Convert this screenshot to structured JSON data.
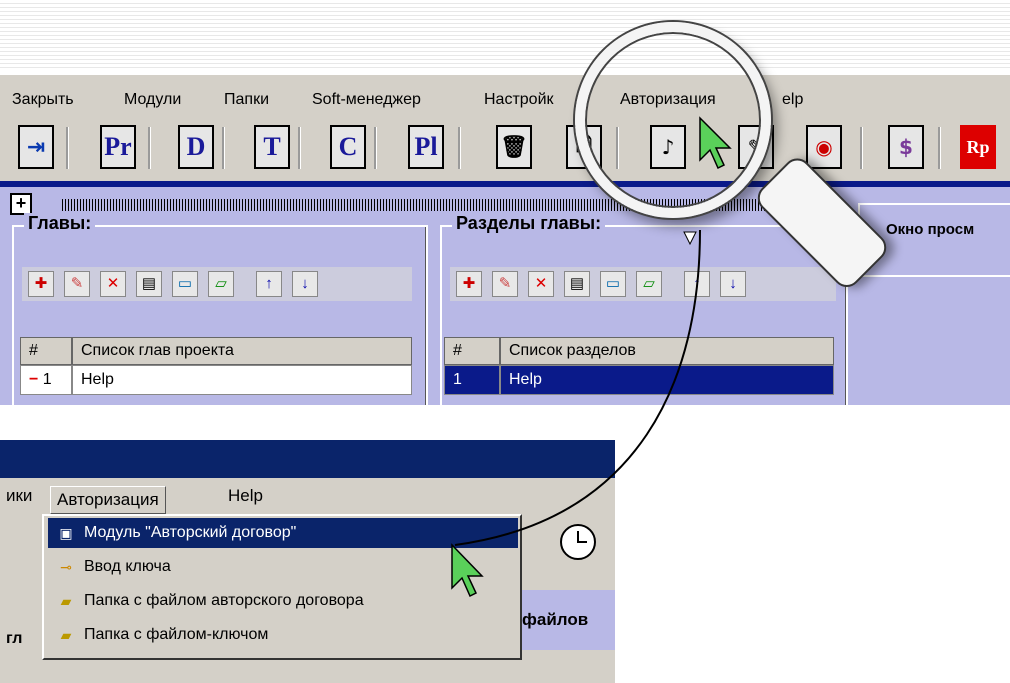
{
  "top_menu": [
    "Закрыть",
    "Модули",
    "Папки",
    "Soft-менеджер",
    "Настройки",
    "Авторизация",
    "Help"
  ],
  "top_menu_visible": [
    "Закрыть",
    "Модули",
    "Папки",
    "Soft-менеджер",
    "Настройк",
    "Авторизация",
    "elp"
  ],
  "toolbar_buttons": [
    {
      "label": "",
      "icon": "exit-icon"
    },
    {
      "label": "Pr",
      "icon": "pr-icon"
    },
    {
      "label": "D",
      "icon": "d-icon"
    },
    {
      "label": "T",
      "icon": "t-icon"
    },
    {
      "label": "C",
      "icon": "c-icon"
    },
    {
      "label": "Pl",
      "icon": "pl-icon"
    },
    {
      "label": "",
      "icon": "trash-icon"
    },
    {
      "label": "",
      "icon": "doc-icon"
    },
    {
      "label": "",
      "icon": "music-doc-icon"
    },
    {
      "label": "",
      "icon": "pencil-icon"
    },
    {
      "label": "",
      "icon": "disc-icon"
    },
    {
      "label": "",
      "icon": "money-icon"
    },
    {
      "label": "Rp",
      "icon": "rvp-icon"
    }
  ],
  "plus_label": "+",
  "chapters": {
    "title": "Главы:",
    "col_num": "#",
    "col_name": "Список глав проекта",
    "row_num": "1",
    "row_name": "Help"
  },
  "sections": {
    "title": "Разделы главы:",
    "col_num": "#",
    "col_name": "Список разделов",
    "row_num": "1",
    "row_name": "Help"
  },
  "viewer_title": "Окно просм",
  "bottom_menu": {
    "left_cut": "ики",
    "active": "Авторизация",
    "help": "Help"
  },
  "dropdown": [
    {
      "label": "Модуль \"Авторский договор\"",
      "icon": "module-icon",
      "selected": true
    },
    {
      "label": "Ввод ключа",
      "icon": "key-icon",
      "selected": false
    },
    {
      "label": "Папка с файлом авторского договора",
      "icon": "folder-open-icon",
      "selected": false
    },
    {
      "label": "Папка с файлом-ключом",
      "icon": "folder-open-icon",
      "selected": false
    }
  ],
  "files_label": "файлов",
  "cut_label": "гл"
}
